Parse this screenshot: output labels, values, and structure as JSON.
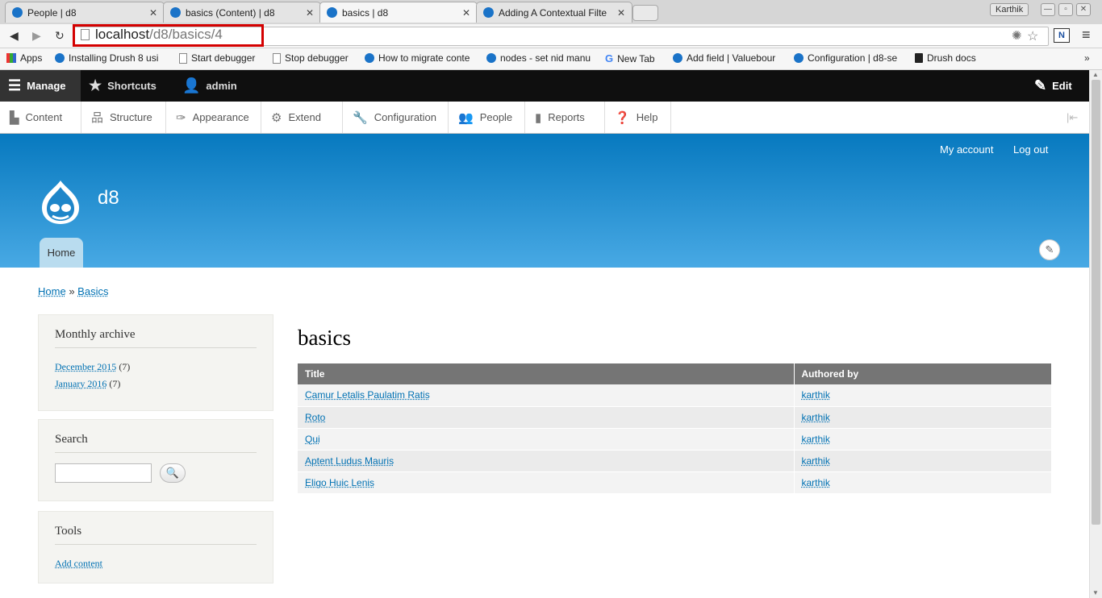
{
  "browser": {
    "tabs": [
      {
        "label": "People | d8",
        "active": false
      },
      {
        "label": "basics (Content) | d8",
        "active": false
      },
      {
        "label": "basics | d8",
        "active": true
      },
      {
        "label": "Adding A Contextual Filte",
        "active": false
      }
    ],
    "profile": "Karthik",
    "url_host": "localhost",
    "url_path": "/d8/basics/4",
    "bookmarks": [
      {
        "label": "Apps",
        "icon": "apps-icon"
      },
      {
        "label": "Installing Drush 8 usi",
        "icon": "drupal-icon"
      },
      {
        "label": "Start debugger",
        "icon": "page-icon"
      },
      {
        "label": "Stop debugger",
        "icon": "page-icon"
      },
      {
        "label": "How to migrate conte",
        "icon": "drupal-icon"
      },
      {
        "label": "nodes - set nid manu",
        "icon": "drupal-icon"
      },
      {
        "label": "New Tab",
        "icon": "google-icon"
      },
      {
        "label": "Add field | Valuebour",
        "icon": "drupal-icon"
      },
      {
        "label": "Configuration | d8-se",
        "icon": "drupal-icon"
      },
      {
        "label": "Drush docs",
        "icon": "book-icon"
      }
    ],
    "bookmarks_more": "»"
  },
  "admin": {
    "manage": "Manage",
    "shortcuts": "Shortcuts",
    "user": "admin",
    "edit": "Edit",
    "menu": [
      "Content",
      "Structure",
      "Appearance",
      "Extend",
      "Configuration",
      "People",
      "Reports",
      "Help"
    ]
  },
  "header": {
    "secondary_menu": [
      "My account",
      "Log out"
    ],
    "site_name": "d8",
    "home_tab": "Home"
  },
  "breadcrumb": {
    "home": "Home",
    "sep": "»",
    "current": "Basics"
  },
  "sidebar": {
    "archive": {
      "title": "Monthly archive",
      "items": [
        {
          "label": "December 2015",
          "count": "(7)"
        },
        {
          "label": "January 2016",
          "count": "(7)"
        }
      ]
    },
    "search": {
      "title": "Search",
      "placeholder": ""
    },
    "tools": {
      "title": "Tools",
      "link": "Add content"
    }
  },
  "main": {
    "title": "basics",
    "columns": [
      "Title",
      "Authored by"
    ],
    "rows": [
      {
        "title": "Camur Letalis Paulatim Ratis",
        "author": "karthik"
      },
      {
        "title": "Roto",
        "author": "karthik"
      },
      {
        "title": "Qui",
        "author": "karthik"
      },
      {
        "title": "Aptent Ludus Mauris",
        "author": "karthik"
      },
      {
        "title": "Eligo Huic Lenis",
        "author": "karthik"
      }
    ]
  },
  "colors": {
    "header_top": "#0779bf",
    "header_bottom": "#48a9e4",
    "link": "#0071b3",
    "table_head": "#757575",
    "highlight": "#d40000"
  }
}
